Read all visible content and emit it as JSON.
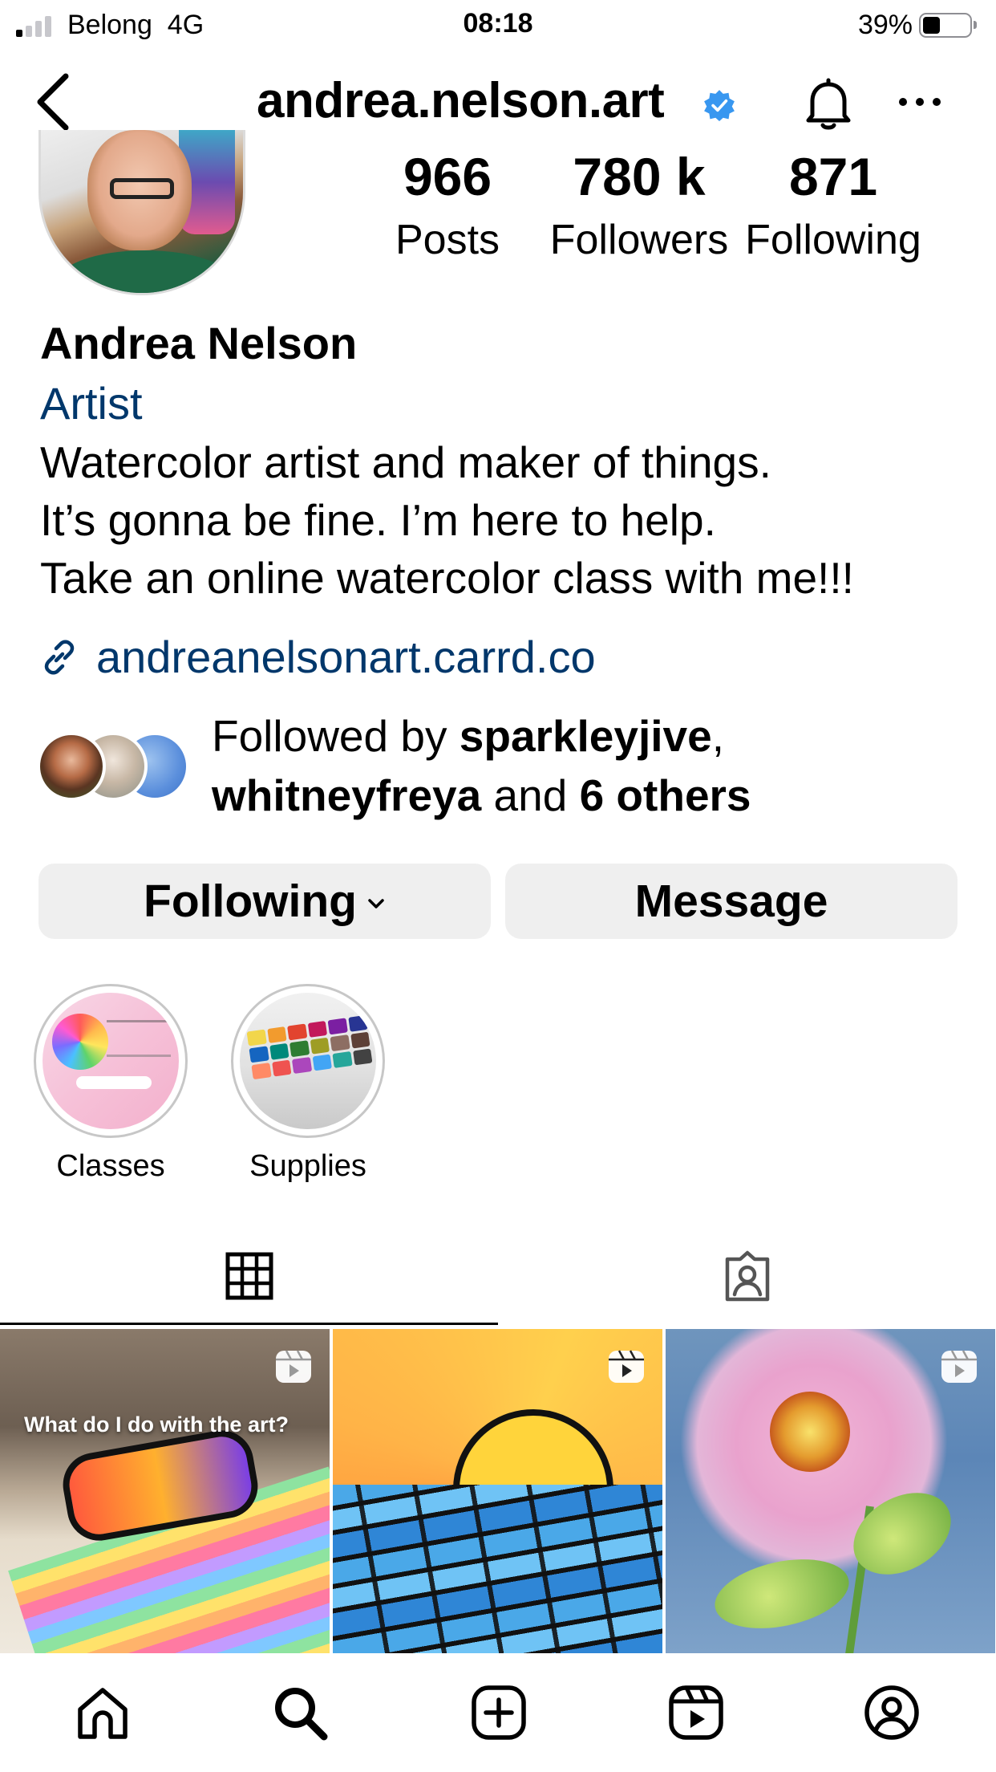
{
  "status_bar": {
    "carrier": "Belong",
    "network": "4G",
    "time": "08:18",
    "battery_pct": "39%",
    "battery_level": 0.39
  },
  "header": {
    "username": "andrea.nelson.art",
    "verified_icon": "verified-badge-icon",
    "back_icon": "chevron-left-icon",
    "bell_icon": "bell-icon",
    "more_icon": "more-horizontal-icon",
    "accent": "#3897f0"
  },
  "profile": {
    "stats": [
      {
        "value": "966",
        "label": "Posts"
      },
      {
        "value": "780 k",
        "label": "Followers"
      },
      {
        "value": "871",
        "label": "Following"
      }
    ],
    "name": "Andrea Nelson",
    "category": "Artist",
    "bio": [
      "Watercolor artist and maker of things.",
      "It’s gonna be fine. I’m here to help.",
      "Take an online watercolor class with me!!!"
    ],
    "link": "andreanelsonart.carrd.co",
    "link_color": "#00376b"
  },
  "followed_by": {
    "prefix": "Followed by ",
    "user1": "sparkleyjive",
    "sep": ",",
    "user2": "whitneyfreya",
    "and": " and ",
    "others": "6 others"
  },
  "actions": {
    "following": "Following",
    "message": "Message"
  },
  "highlights": [
    {
      "label": "Classes"
    },
    {
      "label": "Supplies"
    }
  ],
  "tabs": {
    "grid_icon": "grid-icon",
    "tagged_icon": "tagged-person-icon",
    "active": "grid"
  },
  "posts": [
    {
      "caption": "What do I do with the art?",
      "type": "reel"
    },
    {
      "caption": "",
      "type": "reel"
    },
    {
      "caption": "",
      "type": "reel"
    }
  ],
  "navbar": {
    "items": [
      "home-icon",
      "search-icon",
      "create-post-icon",
      "reels-icon",
      "profile-icon"
    ]
  }
}
